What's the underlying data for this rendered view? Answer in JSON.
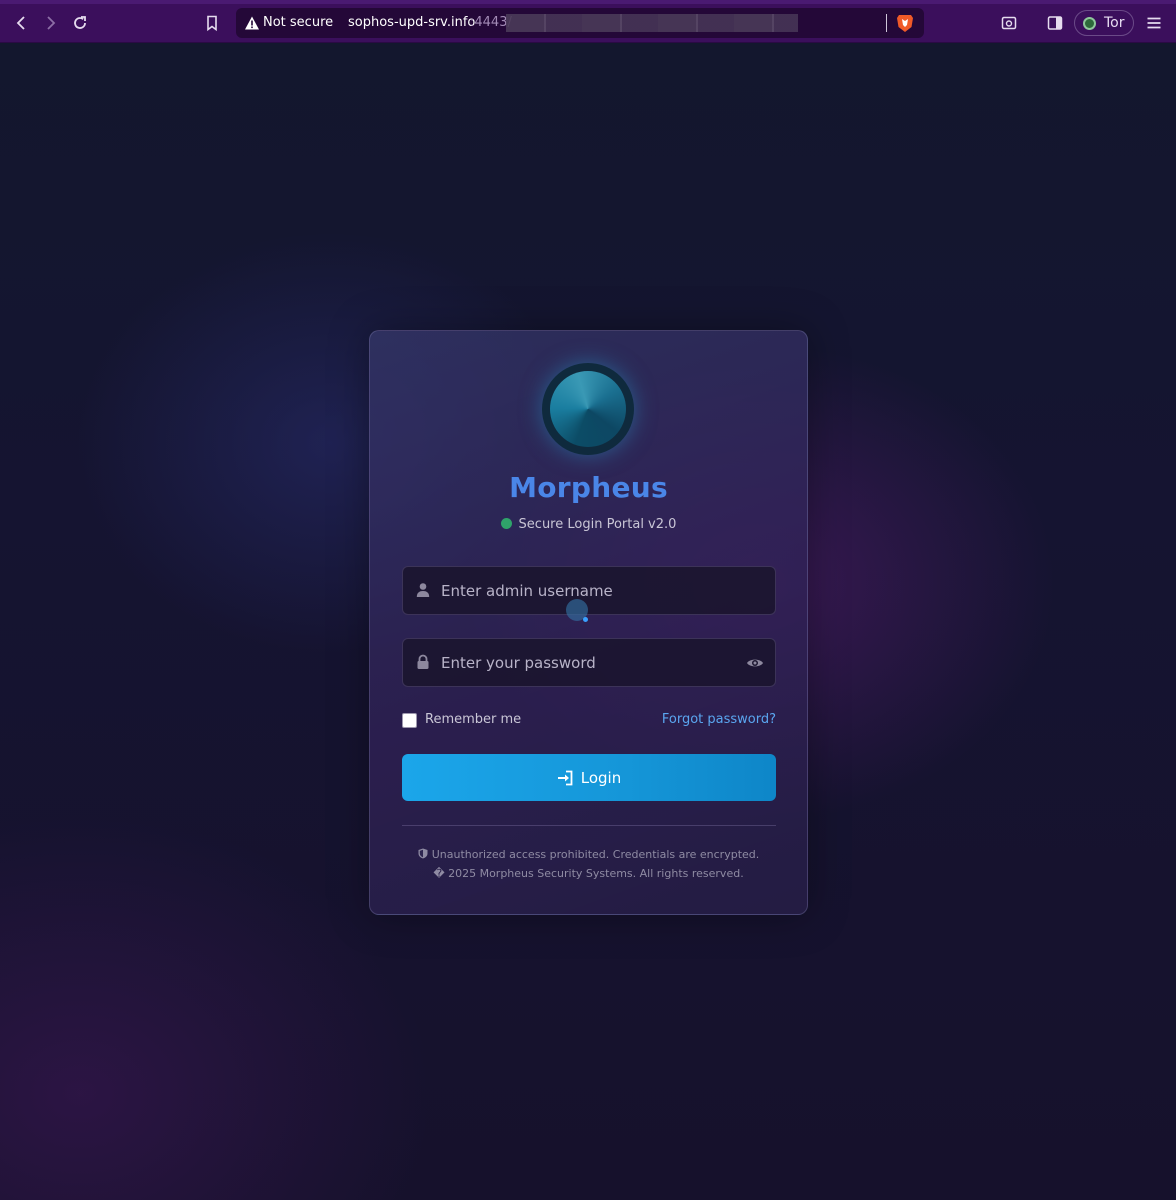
{
  "browser": {
    "security_label": "Not secure",
    "url_host": "sophos-upd-srv.info",
    "url_port": ":4443/",
    "tor_label": "Tor",
    "icons": [
      "back-icon",
      "forward-icon",
      "reload-icon",
      "bookmark-icon",
      "warning-icon",
      "brave-shield-icon",
      "screenshot-icon",
      "sidebar-icon",
      "tor-icon",
      "menu-icon"
    ]
  },
  "login": {
    "brand": "Morpheus",
    "status": "Secure Login Portal v2.0",
    "username_placeholder": "Enter admin username",
    "password_placeholder": "Enter your password",
    "remember_label": "Remember me",
    "forgot_label": "Forgot password?",
    "login_label": "Login",
    "footer_notice": "Unauthorized access prohibited. Credentials are encrypted.",
    "footer_copyright": "� 2025 Morpheus Security Systems. All rights reserved."
  },
  "colors": {
    "brand": "#4a86e8",
    "accent": "#1ba6ea",
    "status_online": "#2fa36a",
    "link": "#5aa6f0",
    "toolbar": "#3b0f5c"
  }
}
